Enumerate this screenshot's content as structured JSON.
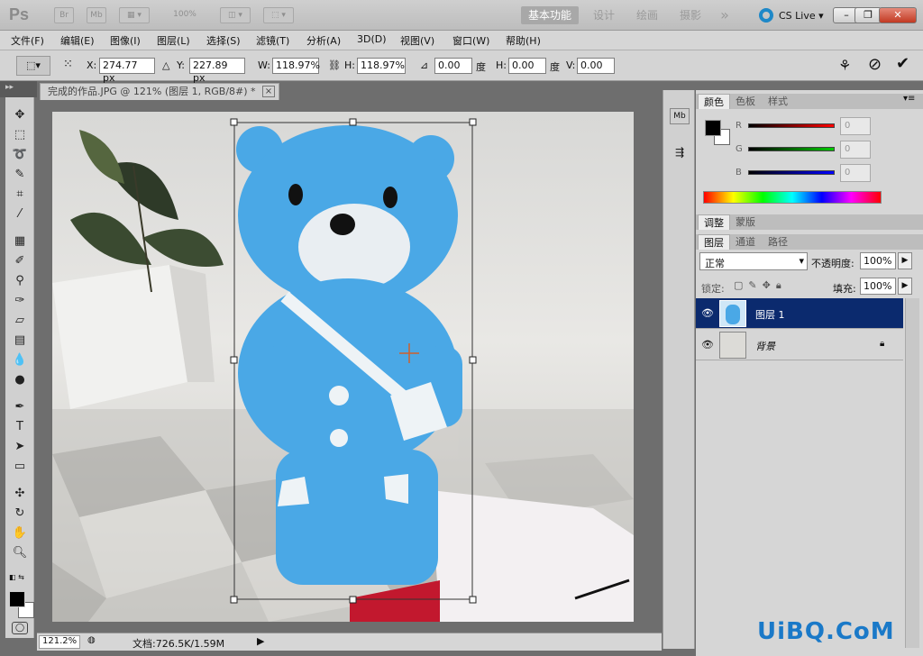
{
  "app": {
    "logo": "Ps",
    "bridge": "Br",
    "minibridge": "Mb",
    "zoom": "100%",
    "cslive": "CS Live"
  },
  "workspaces": [
    {
      "label": "基本功能",
      "active": true
    },
    {
      "label": "设计",
      "active": false
    },
    {
      "label": "绘画",
      "active": false
    },
    {
      "label": "摄影",
      "active": false
    },
    {
      "label": "»",
      "active": false
    }
  ],
  "menu": [
    "文件(F)",
    "编辑(E)",
    "图像(I)",
    "图层(L)",
    "选择(S)",
    "滤镜(T)",
    "分析(A)",
    "3D(D)",
    "视图(V)",
    "窗口(W)",
    "帮助(H)"
  ],
  "options": {
    "x_label": "X:",
    "x": "274.77 px",
    "y_label": "Y:",
    "y": "227.89 px",
    "w_label": "W:",
    "w": "118.97%",
    "h_label": "H:",
    "h": "118.97%",
    "angle": "0.00",
    "angle_unit": "度",
    "hskew_label": "H:",
    "hskew": "0.00",
    "hskew_unit": "度",
    "vskew_label": "V:",
    "vskew": "0.00"
  },
  "document": {
    "tab": "完成的作品.JPG @ 121% (图层 1, RGB/8#) *",
    "close": "×"
  },
  "status": {
    "zoom": "121.2%",
    "doc": "文档:726.5K/1.59M"
  },
  "color_panel": {
    "tabs": [
      "颜色",
      "色板",
      "样式"
    ],
    "labels": [
      "R",
      "G",
      "B"
    ],
    "values": [
      "0",
      "0",
      "0"
    ]
  },
  "adjust_panel": {
    "tabs": [
      "调整",
      "蒙版"
    ]
  },
  "layers_panel": {
    "tabs": [
      "图层",
      "通道",
      "路径"
    ],
    "blend": "正常",
    "opacity_label": "不透明度:",
    "opacity": "100%",
    "lock_label": "锁定:",
    "fill_label": "填充:",
    "fill": "100%",
    "layers": [
      {
        "name": "图层 1",
        "selected": true
      },
      {
        "name": "背景",
        "selected": false
      }
    ]
  },
  "watermark": "UiBQ.CoM",
  "colors": {
    "selection": "#0b2a6e",
    "bear": "#4aa8e6"
  }
}
